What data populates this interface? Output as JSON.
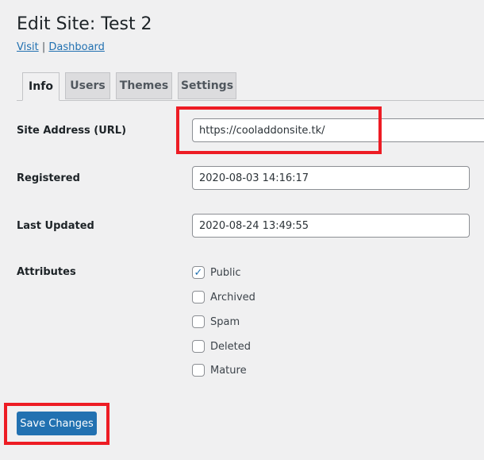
{
  "header": {
    "title": "Edit Site: Test 2",
    "visit_link": "Visit",
    "separator": "|",
    "dashboard_link": "Dashboard"
  },
  "tabs": [
    {
      "label": "Info",
      "active": true
    },
    {
      "label": "Users"
    },
    {
      "label": "Themes"
    },
    {
      "label": "Settings"
    }
  ],
  "form": {
    "site_address": {
      "label": "Site Address (URL)",
      "value": "https://cooladdonsite.tk/"
    },
    "registered": {
      "label": "Registered",
      "value": "2020-08-03 14:16:17"
    },
    "last_updated": {
      "label": "Last Updated",
      "value": "2020-08-24 13:49:55"
    },
    "attributes": {
      "label": "Attributes",
      "options": [
        {
          "label": "Public",
          "checked": true
        },
        {
          "label": "Archived",
          "checked": false
        },
        {
          "label": "Spam",
          "checked": false
        },
        {
          "label": "Deleted",
          "checked": false
        },
        {
          "label": "Mature",
          "checked": false
        }
      ]
    },
    "save_label": "Save Changes"
  },
  "colors": {
    "highlight": "#ed1c24",
    "primary": "#2271b1",
    "background": "#f0f0f1"
  }
}
